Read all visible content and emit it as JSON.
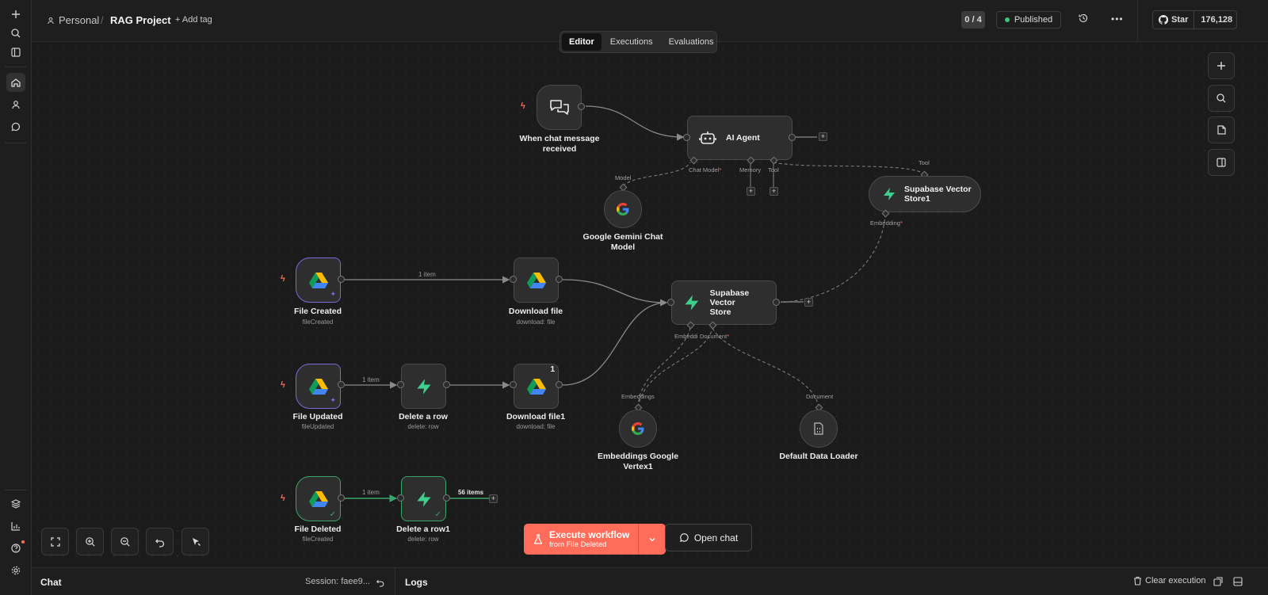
{
  "header": {
    "breadcrumb": {
      "workspace": "Personal",
      "separator": "/",
      "project": "RAG Project",
      "add_tag": "+ Add tag"
    },
    "counter": "0 / 4",
    "status": "Published",
    "status_color": "#3ec47a",
    "github": {
      "star_label": "Star",
      "count": "176,128"
    }
  },
  "tabs": [
    "Editor",
    "Executions",
    "Evaluations"
  ],
  "active_tab": "Editor",
  "nodes": {
    "chat_trigger": {
      "label_line1": "When chat message",
      "label_line2": "received"
    },
    "ai_agent": {
      "title": "AI Agent",
      "ports": {
        "chat_model": "Chat Model",
        "memory": "Memory",
        "tool": "Tool"
      }
    },
    "gemini": {
      "label_line1": "Google Gemini Chat",
      "label_line2": "Model",
      "port": "Model"
    },
    "supabase_store1": {
      "title_line1": "Supabase Vector",
      "title_line2": "Store1",
      "port_top": "Tool",
      "port_bottom": "Embedding"
    },
    "file_created": {
      "label": "File Created",
      "sub": "fileCreated"
    },
    "download_file": {
      "label": "Download file",
      "sub": "download: file"
    },
    "supabase_store": {
      "title_line1": "Supabase Vector",
      "title_line2": "Store",
      "port_embedding": "Embeddi",
      "port_document": "Document"
    },
    "file_updated": {
      "label": "File Updated",
      "sub": "fileUpdated"
    },
    "delete_row": {
      "label": "Delete a row",
      "sub": "delete: row"
    },
    "download_file1": {
      "label": "Download file1",
      "sub": "download: file",
      "badge": "1"
    },
    "embeddings": {
      "label_line1": "Embeddings Google",
      "label_line2": "Vertex1",
      "port": "Embeddings"
    },
    "data_loader": {
      "label": "Default Data Loader",
      "port": "Document"
    },
    "file_deleted": {
      "label": "File Deleted",
      "sub": "fileCreated"
    },
    "delete_row1": {
      "label": "Delete a row1",
      "sub": "delete: row"
    }
  },
  "edge_labels": {
    "created_to_download": "1 item",
    "updated_to_delete": "1 item",
    "deleted_to_delete": "1 item",
    "delete1_out": "56 items"
  },
  "execute": {
    "title": "Execute workflow",
    "subtitle": "from File Deleted"
  },
  "open_chat": "Open chat",
  "bottom": {
    "chat": "Chat",
    "session": "Session: faee9...",
    "logs": "Logs",
    "clear": "Clear execution"
  },
  "colors": {
    "accent": "#ff6d5a",
    "supabase": "#3ecf8e",
    "trigger_border": "#7b6ad8",
    "success_border": "#3aa46a"
  }
}
